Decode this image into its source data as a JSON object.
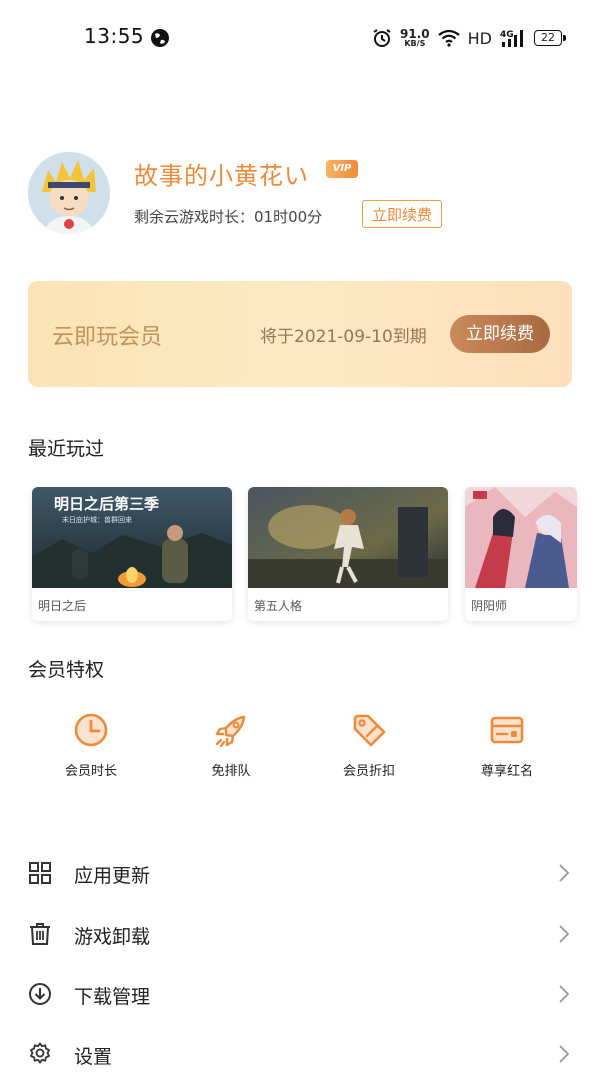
{
  "status_bar": {
    "time": "13:55",
    "net_speed_value": "91.0",
    "net_speed_unit": "KB/S",
    "hd_label": "HD",
    "network_label": "4G",
    "battery": "22"
  },
  "profile": {
    "username": "故事的小黄花い",
    "vip_badge": "VIP",
    "remaining_time": "剩余云游戏时长：01时00分",
    "renew_button": "立即续费"
  },
  "membership_card": {
    "title": "云即玩会员",
    "expiry": "将于2021-09-10到期",
    "renew_button": "立即续费"
  },
  "recently_played": {
    "title": "最近玩过",
    "games": [
      {
        "name": "明日之后",
        "banner": "明日之后第三季",
        "subbanner": "末日庇护城：兽群回来"
      },
      {
        "name": "第五人格"
      },
      {
        "name": "阴阳师"
      }
    ]
  },
  "privileges": {
    "title": "会员特权",
    "items": [
      {
        "label": "会员时长",
        "icon": "clock-icon"
      },
      {
        "label": "免排队",
        "icon": "rocket-icon"
      },
      {
        "label": "会员折扣",
        "icon": "tag-icon"
      },
      {
        "label": "尊享红名",
        "icon": "card-icon"
      }
    ]
  },
  "menu": [
    {
      "label": "应用更新",
      "icon": "grid-icon"
    },
    {
      "label": "游戏卸载",
      "icon": "trash-icon"
    },
    {
      "label": "下载管理",
      "icon": "download-icon"
    },
    {
      "label": "设置",
      "icon": "gear-icon"
    }
  ],
  "colors": {
    "accent": "#ee8b3a",
    "card_gold": "#fbe3b4",
    "renew_brown": "#b47650"
  }
}
